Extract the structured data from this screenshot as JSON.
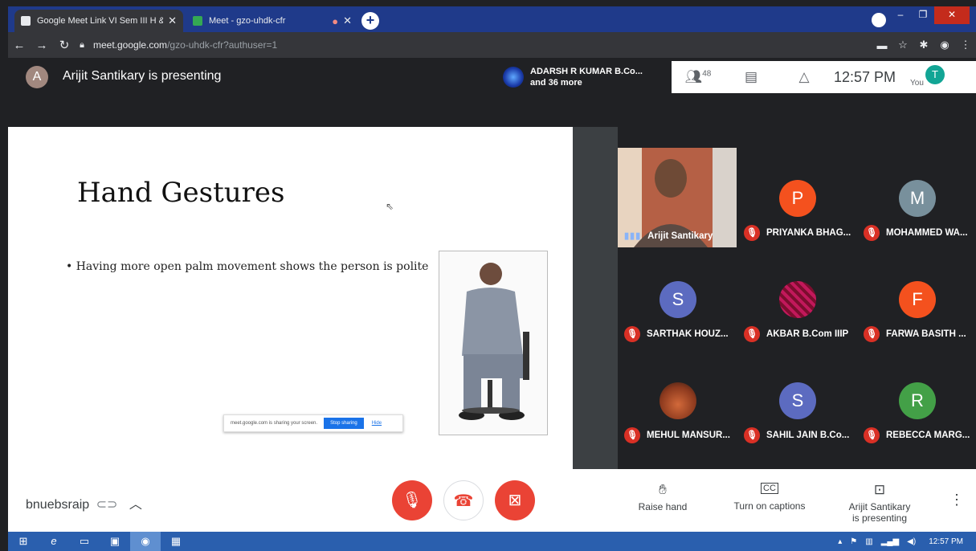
{
  "browser": {
    "tabs": [
      {
        "title": "Google Meet Link VI Sem III H &",
        "active": true
      },
      {
        "title": "Meet - gzo-uhdk-cfr",
        "active": false
      }
    ],
    "url_domain": "meet.google.com",
    "url_path": "/gzo-uhdk-cfr?authuser=1"
  },
  "meet": {
    "presenter_initial": "A",
    "presenting_title": "Arijit Santikary is presenting",
    "active_speaker": "ADARSH R KUMAR B.Co...",
    "active_speaker_more": "and 36 more",
    "participant_count": "48",
    "time": "12:57 PM",
    "you_label": "You",
    "you_initial": "T"
  },
  "slide": {
    "title": "Hand Gestures",
    "bullet": "Having more open palm movement shows the person is polite",
    "share_text": "meet.google.com is sharing your screen.",
    "stop_sharing": "Stop sharing",
    "hide": "Hide"
  },
  "participants": [
    {
      "name": "Arijit Santikary",
      "initial": "",
      "color": "",
      "video": true,
      "muted": false
    },
    {
      "name": "PRIYANKA BHAG...",
      "initial": "P",
      "color": "#f4511e",
      "video": false,
      "muted": true
    },
    {
      "name": "MOHAMMED WA...",
      "initial": "M",
      "color": "#78909c",
      "video": false,
      "muted": true
    },
    {
      "name": "SARTHAK HOUZ...",
      "initial": "S",
      "color": "#5c6bc0",
      "video": false,
      "muted": true
    },
    {
      "name": "AKBAR B.Com IIIP",
      "initial": "",
      "color": "#c2185b",
      "video": false,
      "muted": true
    },
    {
      "name": "FARWA BASITH ...",
      "initial": "F",
      "color": "#f4511e",
      "video": false,
      "muted": true
    },
    {
      "name": "MEHUL MANSUR...",
      "initial": "",
      "color": "#8d4a2a",
      "video": false,
      "muted": true
    },
    {
      "name": "SAHIL JAIN B.Co...",
      "initial": "S",
      "color": "#5c6bc0",
      "video": false,
      "muted": true
    },
    {
      "name": "REBECCA MARG...",
      "initial": "R",
      "color": "#43a047",
      "video": false,
      "muted": true
    }
  ],
  "bottom": {
    "meeting_code": "bnuebsraip",
    "raise_hand": "Raise hand",
    "captions": "Turn on captions",
    "presenting_line1": "Arijit Santikary",
    "presenting_line2": "is presenting"
  },
  "taskbar": {
    "time": "12:57 PM"
  }
}
